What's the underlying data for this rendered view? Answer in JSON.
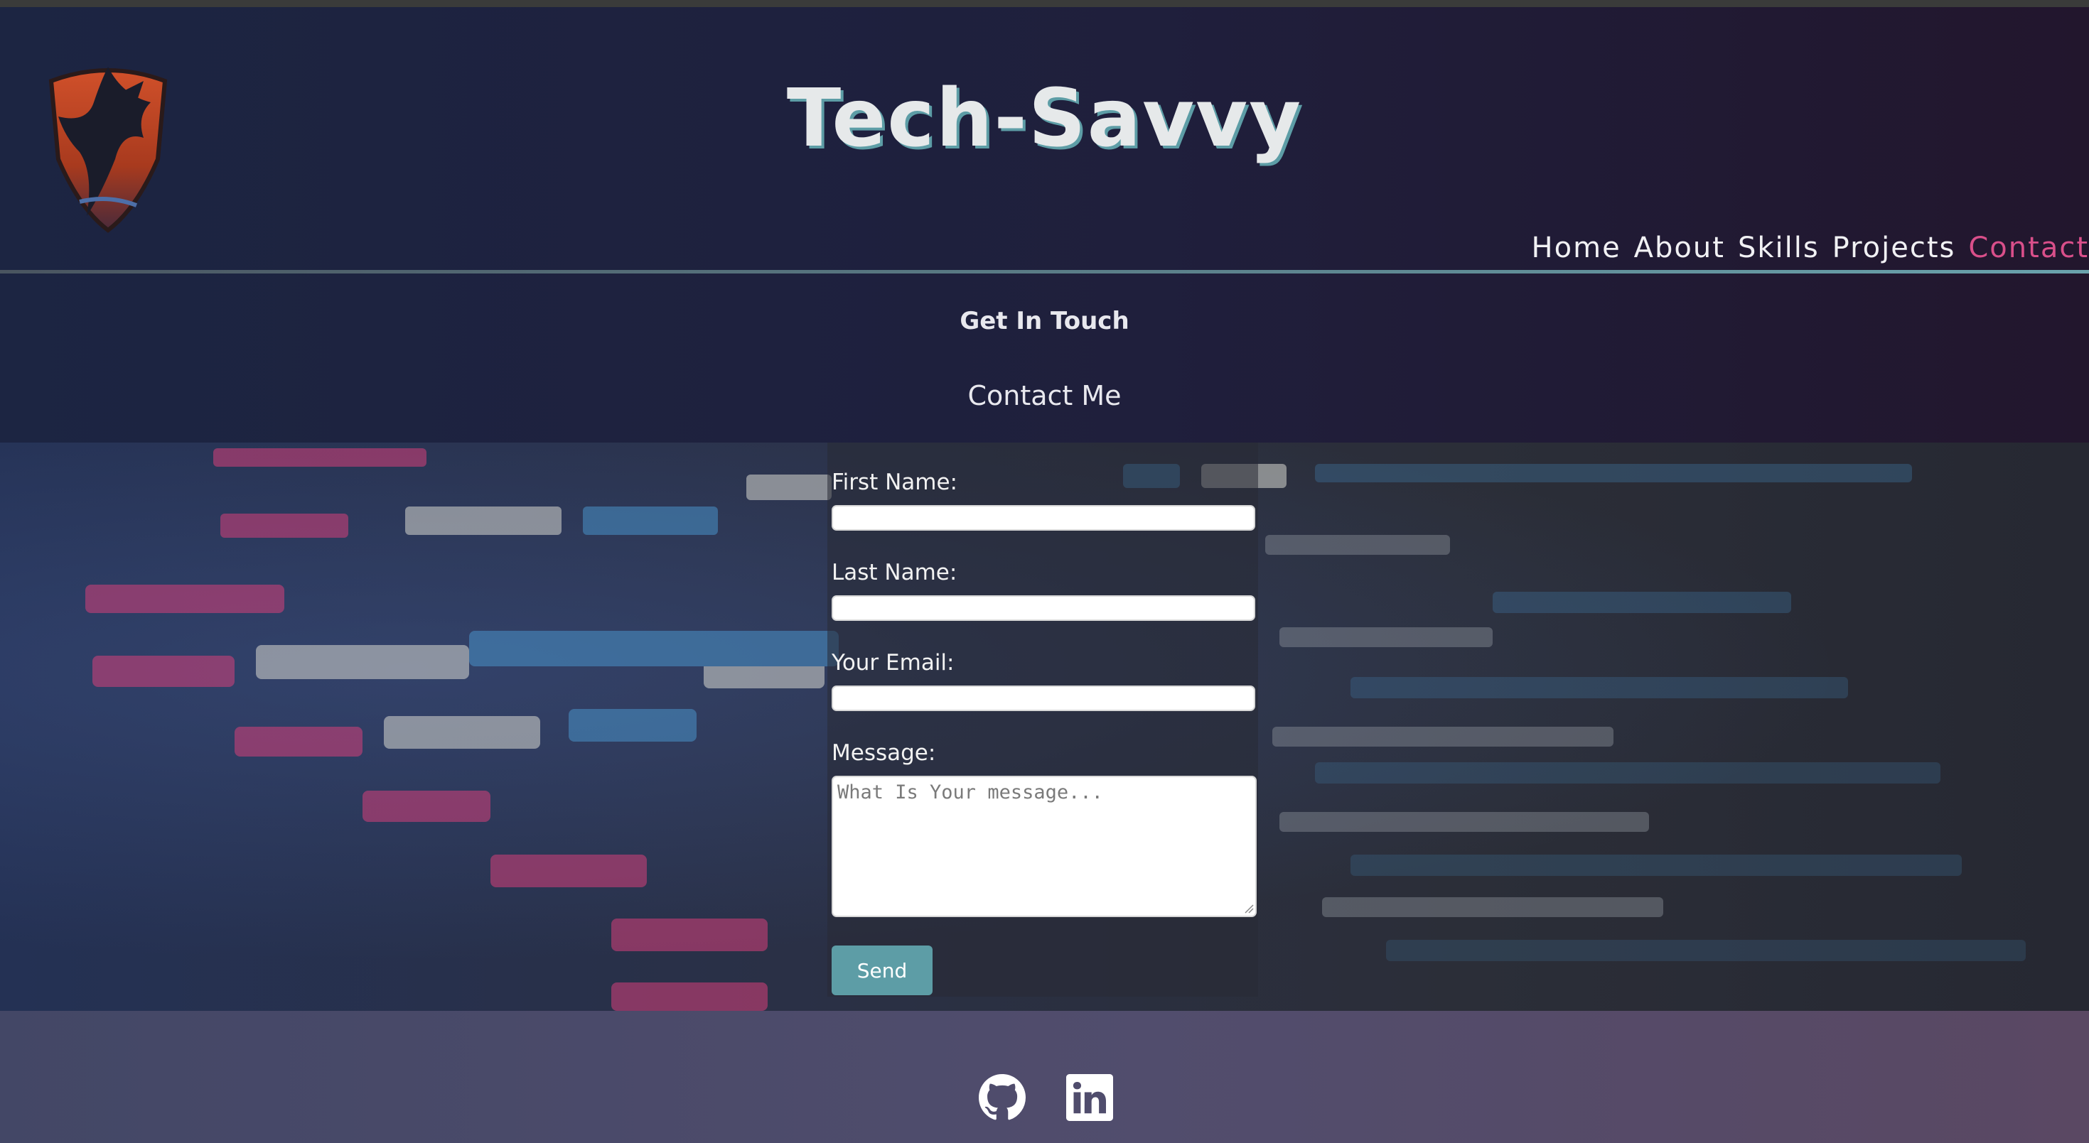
{
  "header": {
    "site_title": "Tech-Savvy",
    "nav": [
      {
        "label": "Home"
      },
      {
        "label": "About"
      },
      {
        "label": "Skills"
      },
      {
        "label": "Projects"
      },
      {
        "label": "Contact",
        "active": true
      }
    ]
  },
  "intro": {
    "heading": "Get In Touch",
    "subheading": "Contact Me"
  },
  "form": {
    "first_name_label": "First Name:",
    "last_name_label": "Last Name:",
    "email_label": "Your Email:",
    "message_label": "Message:",
    "message_placeholder": "What Is Your message...",
    "send_label": "Send"
  },
  "footer": {
    "icons": [
      "github-icon",
      "linkedin-icon"
    ]
  },
  "colors": {
    "accent": "#5d9da6",
    "active_nav": "#d94f8a",
    "header_bg": "#1c2542",
    "footer_bg": "#4a4a6b"
  }
}
